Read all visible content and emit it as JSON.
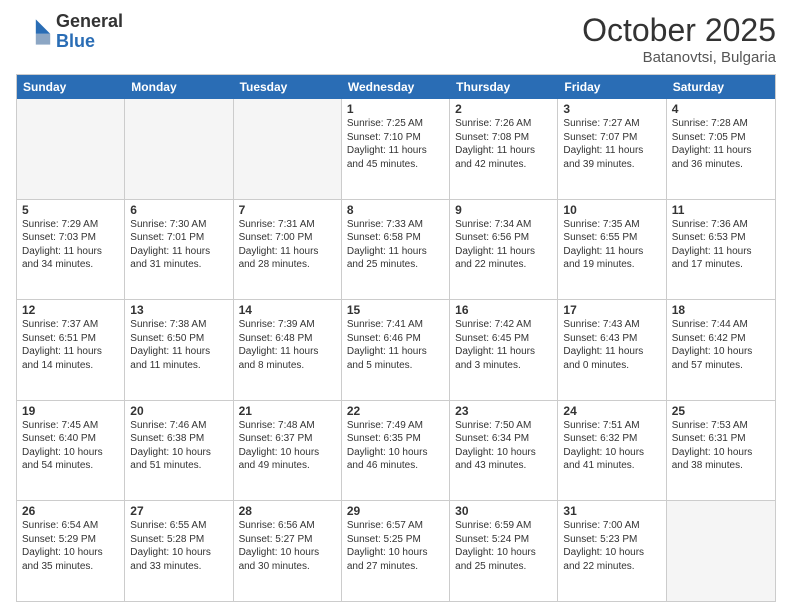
{
  "logo": {
    "general": "General",
    "blue": "Blue"
  },
  "title": "October 2025",
  "location": "Batanovtsi, Bulgaria",
  "header_days": [
    "Sunday",
    "Monday",
    "Tuesday",
    "Wednesday",
    "Thursday",
    "Friday",
    "Saturday"
  ],
  "rows": [
    [
      {
        "day": "",
        "sunrise": "",
        "sunset": "",
        "daylight": "",
        "empty": true
      },
      {
        "day": "",
        "sunrise": "",
        "sunset": "",
        "daylight": "",
        "empty": true
      },
      {
        "day": "",
        "sunrise": "",
        "sunset": "",
        "daylight": "",
        "empty": true
      },
      {
        "day": "1",
        "sunrise": "Sunrise: 7:25 AM",
        "sunset": "Sunset: 7:10 PM",
        "daylight": "Daylight: 11 hours and 45 minutes."
      },
      {
        "day": "2",
        "sunrise": "Sunrise: 7:26 AM",
        "sunset": "Sunset: 7:08 PM",
        "daylight": "Daylight: 11 hours and 42 minutes."
      },
      {
        "day": "3",
        "sunrise": "Sunrise: 7:27 AM",
        "sunset": "Sunset: 7:07 PM",
        "daylight": "Daylight: 11 hours and 39 minutes."
      },
      {
        "day": "4",
        "sunrise": "Sunrise: 7:28 AM",
        "sunset": "Sunset: 7:05 PM",
        "daylight": "Daylight: 11 hours and 36 minutes."
      }
    ],
    [
      {
        "day": "5",
        "sunrise": "Sunrise: 7:29 AM",
        "sunset": "Sunset: 7:03 PM",
        "daylight": "Daylight: 11 hours and 34 minutes."
      },
      {
        "day": "6",
        "sunrise": "Sunrise: 7:30 AM",
        "sunset": "Sunset: 7:01 PM",
        "daylight": "Daylight: 11 hours and 31 minutes."
      },
      {
        "day": "7",
        "sunrise": "Sunrise: 7:31 AM",
        "sunset": "Sunset: 7:00 PM",
        "daylight": "Daylight: 11 hours and 28 minutes."
      },
      {
        "day": "8",
        "sunrise": "Sunrise: 7:33 AM",
        "sunset": "Sunset: 6:58 PM",
        "daylight": "Daylight: 11 hours and 25 minutes."
      },
      {
        "day": "9",
        "sunrise": "Sunrise: 7:34 AM",
        "sunset": "Sunset: 6:56 PM",
        "daylight": "Daylight: 11 hours and 22 minutes."
      },
      {
        "day": "10",
        "sunrise": "Sunrise: 7:35 AM",
        "sunset": "Sunset: 6:55 PM",
        "daylight": "Daylight: 11 hours and 19 minutes."
      },
      {
        "day": "11",
        "sunrise": "Sunrise: 7:36 AM",
        "sunset": "Sunset: 6:53 PM",
        "daylight": "Daylight: 11 hours and 17 minutes."
      }
    ],
    [
      {
        "day": "12",
        "sunrise": "Sunrise: 7:37 AM",
        "sunset": "Sunset: 6:51 PM",
        "daylight": "Daylight: 11 hours and 14 minutes."
      },
      {
        "day": "13",
        "sunrise": "Sunrise: 7:38 AM",
        "sunset": "Sunset: 6:50 PM",
        "daylight": "Daylight: 11 hours and 11 minutes."
      },
      {
        "day": "14",
        "sunrise": "Sunrise: 7:39 AM",
        "sunset": "Sunset: 6:48 PM",
        "daylight": "Daylight: 11 hours and 8 minutes."
      },
      {
        "day": "15",
        "sunrise": "Sunrise: 7:41 AM",
        "sunset": "Sunset: 6:46 PM",
        "daylight": "Daylight: 11 hours and 5 minutes."
      },
      {
        "day": "16",
        "sunrise": "Sunrise: 7:42 AM",
        "sunset": "Sunset: 6:45 PM",
        "daylight": "Daylight: 11 hours and 3 minutes."
      },
      {
        "day": "17",
        "sunrise": "Sunrise: 7:43 AM",
        "sunset": "Sunset: 6:43 PM",
        "daylight": "Daylight: 11 hours and 0 minutes."
      },
      {
        "day": "18",
        "sunrise": "Sunrise: 7:44 AM",
        "sunset": "Sunset: 6:42 PM",
        "daylight": "Daylight: 10 hours and 57 minutes."
      }
    ],
    [
      {
        "day": "19",
        "sunrise": "Sunrise: 7:45 AM",
        "sunset": "Sunset: 6:40 PM",
        "daylight": "Daylight: 10 hours and 54 minutes."
      },
      {
        "day": "20",
        "sunrise": "Sunrise: 7:46 AM",
        "sunset": "Sunset: 6:38 PM",
        "daylight": "Daylight: 10 hours and 51 minutes."
      },
      {
        "day": "21",
        "sunrise": "Sunrise: 7:48 AM",
        "sunset": "Sunset: 6:37 PM",
        "daylight": "Daylight: 10 hours and 49 minutes."
      },
      {
        "day": "22",
        "sunrise": "Sunrise: 7:49 AM",
        "sunset": "Sunset: 6:35 PM",
        "daylight": "Daylight: 10 hours and 46 minutes."
      },
      {
        "day": "23",
        "sunrise": "Sunrise: 7:50 AM",
        "sunset": "Sunset: 6:34 PM",
        "daylight": "Daylight: 10 hours and 43 minutes."
      },
      {
        "day": "24",
        "sunrise": "Sunrise: 7:51 AM",
        "sunset": "Sunset: 6:32 PM",
        "daylight": "Daylight: 10 hours and 41 minutes."
      },
      {
        "day": "25",
        "sunrise": "Sunrise: 7:53 AM",
        "sunset": "Sunset: 6:31 PM",
        "daylight": "Daylight: 10 hours and 38 minutes."
      }
    ],
    [
      {
        "day": "26",
        "sunrise": "Sunrise: 6:54 AM",
        "sunset": "Sunset: 5:29 PM",
        "daylight": "Daylight: 10 hours and 35 minutes."
      },
      {
        "day": "27",
        "sunrise": "Sunrise: 6:55 AM",
        "sunset": "Sunset: 5:28 PM",
        "daylight": "Daylight: 10 hours and 33 minutes."
      },
      {
        "day": "28",
        "sunrise": "Sunrise: 6:56 AM",
        "sunset": "Sunset: 5:27 PM",
        "daylight": "Daylight: 10 hours and 30 minutes."
      },
      {
        "day": "29",
        "sunrise": "Sunrise: 6:57 AM",
        "sunset": "Sunset: 5:25 PM",
        "daylight": "Daylight: 10 hours and 27 minutes."
      },
      {
        "day": "30",
        "sunrise": "Sunrise: 6:59 AM",
        "sunset": "Sunset: 5:24 PM",
        "daylight": "Daylight: 10 hours and 25 minutes."
      },
      {
        "day": "31",
        "sunrise": "Sunrise: 7:00 AM",
        "sunset": "Sunset: 5:23 PM",
        "daylight": "Daylight: 10 hours and 22 minutes."
      },
      {
        "day": "",
        "sunrise": "",
        "sunset": "",
        "daylight": "",
        "empty": true
      }
    ]
  ]
}
